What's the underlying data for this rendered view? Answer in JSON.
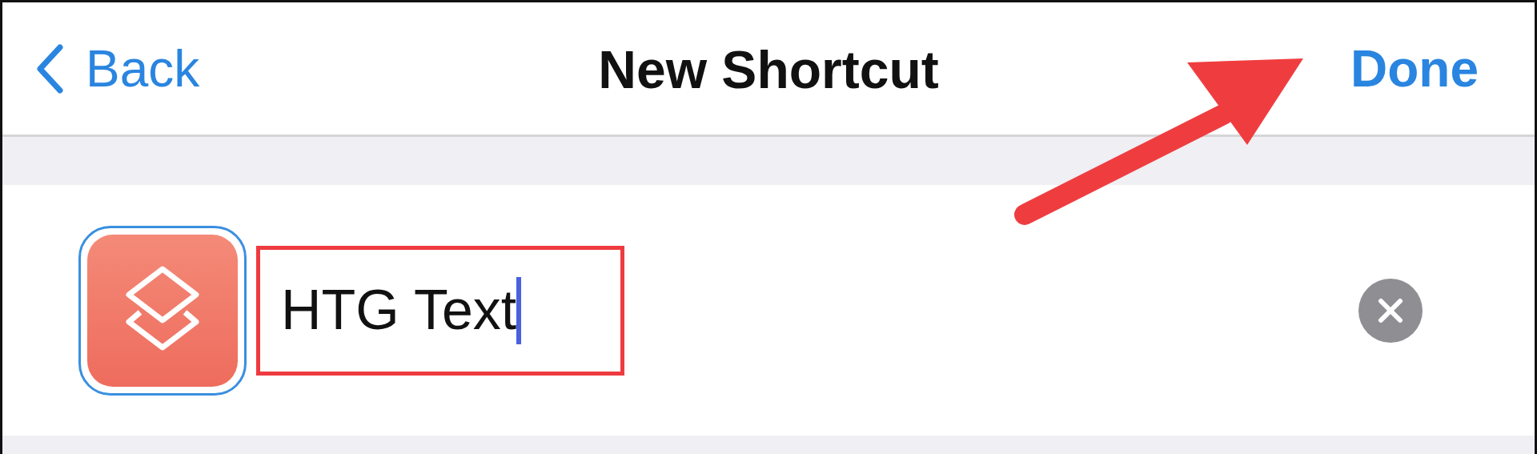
{
  "nav_bar": {
    "back_label": "Back",
    "title": "New Shortcut",
    "done_label": "Done"
  },
  "shortcut": {
    "name": "HTG Text",
    "focused": true
  }
}
